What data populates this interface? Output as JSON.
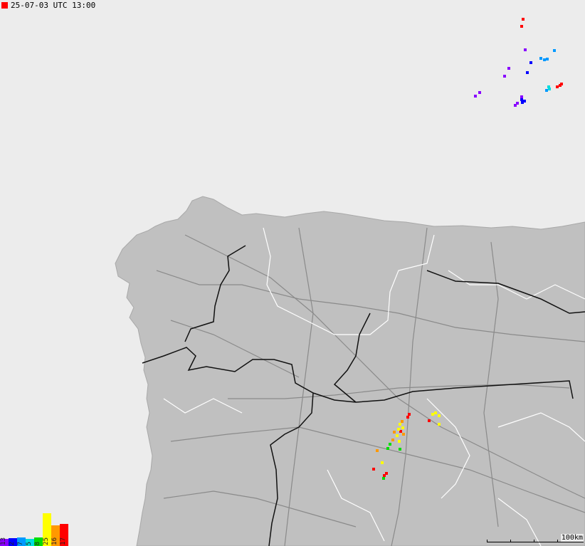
{
  "timestamp": {
    "text": "25-07-03 UTC 13:00",
    "marker_color": "#ff0000"
  },
  "legend": {
    "bars": [
      {
        "label": "13",
        "color": "#8800ff",
        "level": 0.2
      },
      {
        "label": "2",
        "color": "#0000ff",
        "level": 0.22
      },
      {
        "label": "7",
        "color": "#0099ff",
        "level": 0.25
      },
      {
        "label": "5",
        "color": "#00dddd",
        "level": 0.2
      },
      {
        "label": "8",
        "color": "#00dd00",
        "level": 0.25
      },
      {
        "label": "25",
        "color": "#ffff00",
        "level": 0.95
      },
      {
        "label": "16",
        "color": "#ff9900",
        "level": 0.6
      },
      {
        "label": "17",
        "color": "#ff0000",
        "level": 0.65
      }
    ]
  },
  "scale": {
    "label": "100km"
  },
  "map": {
    "land_color": "#c0c0c0",
    "sea_color": "#ececec",
    "border_color": "#111111",
    "region_line_color": "#ffffff",
    "road_color": "#8a8a8a",
    "strike_groups": [
      {
        "color": "#ff0000",
        "points": [
          [
            735,
            27
          ],
          [
            733,
            37
          ],
          [
            787,
            120
          ],
          [
            783,
            122
          ],
          [
            789,
            118
          ],
          [
            563,
            606
          ],
          [
            575,
            582
          ],
          [
            573,
            586
          ],
          [
            603,
            591
          ],
          [
            525,
            659
          ],
          [
            540,
            668
          ],
          [
            543,
            665
          ]
        ]
      },
      {
        "color": "#8800ff",
        "points": [
          [
            738,
            70
          ],
          [
            715,
            96
          ],
          [
            709,
            107
          ],
          [
            668,
            135
          ],
          [
            674,
            130
          ],
          [
            733,
            136
          ],
          [
            724,
            148
          ],
          [
            727,
            145
          ]
        ]
      },
      {
        "color": "#0000ff",
        "points": [
          [
            746,
            88
          ],
          [
            741,
            102
          ],
          [
            734,
            144
          ],
          [
            733,
            140
          ],
          [
            737,
            142
          ]
        ]
      },
      {
        "color": "#0099ff",
        "points": [
          [
            760,
            82
          ],
          [
            765,
            84
          ],
          [
            779,
            71
          ],
          [
            769,
            83
          ],
          [
            768,
            127
          ]
        ]
      },
      {
        "color": "#00dddd",
        "points": [
          [
            771,
            122
          ],
          [
            772,
            125
          ]
        ]
      },
      {
        "color": "#ffff00",
        "points": [
          [
            608,
            582
          ],
          [
            612,
            580
          ],
          [
            617,
            584
          ],
          [
            617,
            596
          ],
          [
            562,
            596
          ],
          [
            560,
            603
          ],
          [
            558,
            612
          ],
          [
            561,
            620
          ],
          [
            566,
            601
          ],
          [
            537,
            650
          ]
        ]
      },
      {
        "color": "#ff9900",
        "points": [
          [
            565,
            592
          ],
          [
            554,
            607
          ],
          [
            552,
            618
          ],
          [
            530,
            633
          ],
          [
            567,
            610
          ]
        ]
      },
      {
        "color": "#00dd00",
        "points": [
          [
            548,
            624
          ],
          [
            545,
            630
          ],
          [
            562,
            631
          ],
          [
            539,
            672
          ]
        ]
      }
    ]
  }
}
